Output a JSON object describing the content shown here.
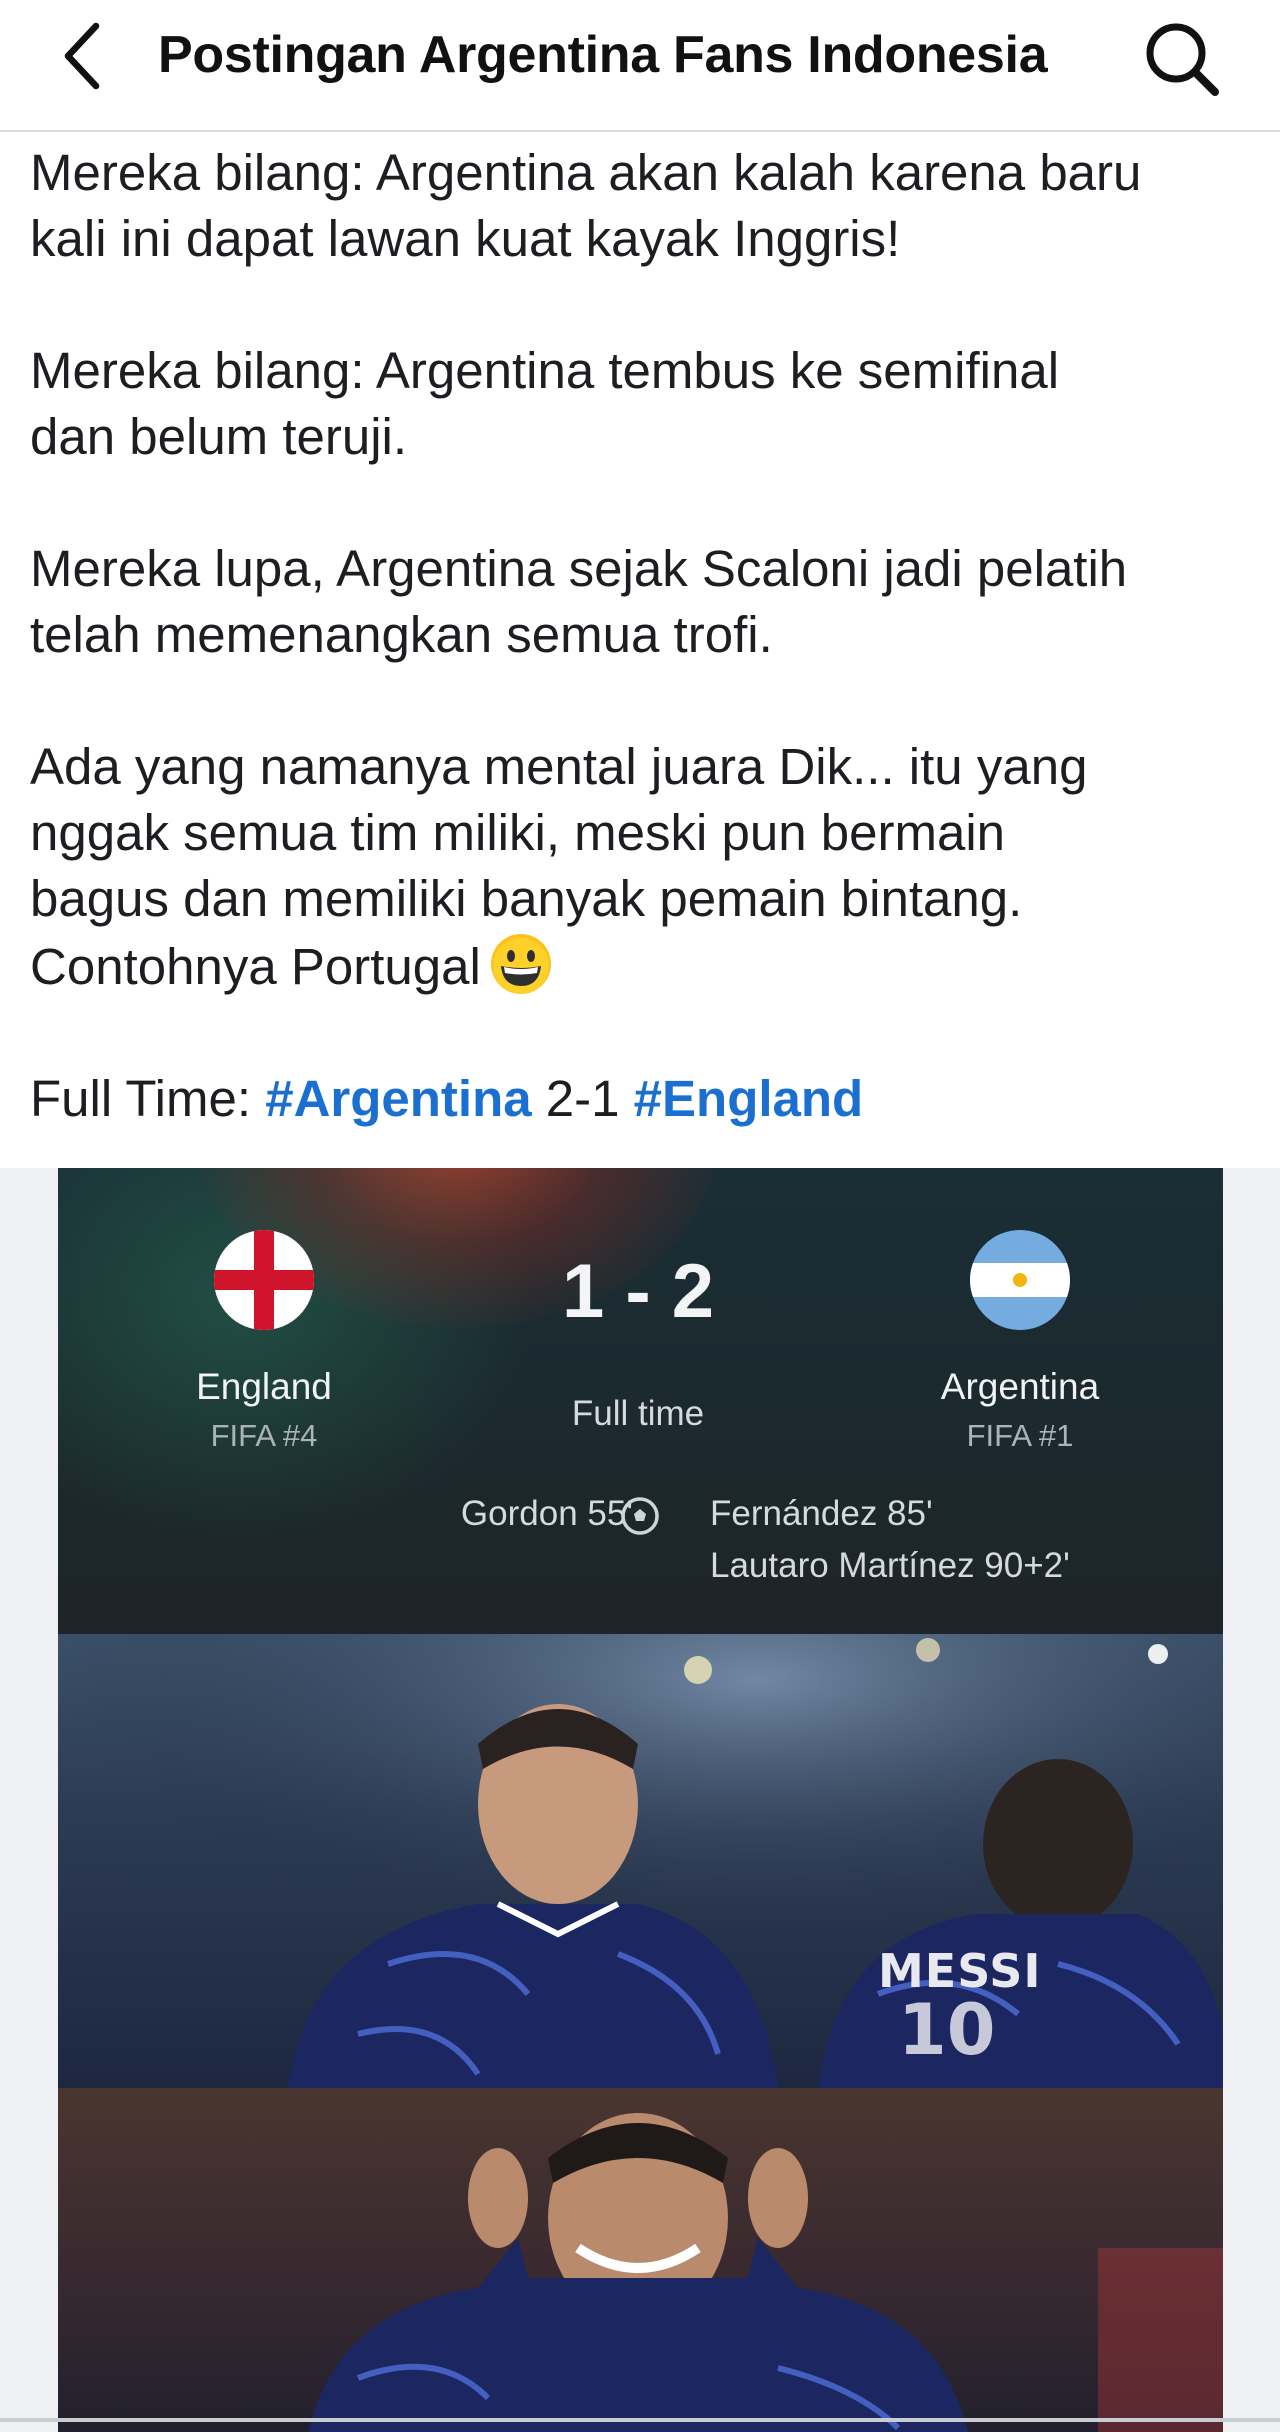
{
  "header": {
    "title": "Postingan Argentina Fans Indonesia",
    "back_icon": "chevron-left-icon",
    "search_icon": "search-icon"
  },
  "post": {
    "paragraphs": [
      [
        "Mereka bilang: Argentina akan kalah karena baru",
        "kali ini dapat lawan kuat kayak Inggris!"
      ],
      [
        "Mereka bilang: Argentina tembus ke semifinal",
        "dan belum teruji."
      ],
      [
        "Mereka lupa, Argentina sejak Scaloni jadi pelatih",
        "telah memenangkan semua trofi."
      ],
      [
        "Ada yang namanya mental juara Dik... itu yang",
        "nggak semua tim miliki, meski pun bermain",
        "bagus dan memiliki banyak pemain bintang.",
        "Contohnya Portugal"
      ]
    ],
    "final_prefix": "Full Time: ",
    "hashtag1": "#Argentina",
    "score_text": " 2-1 ",
    "hashtag2": "#England",
    "emoji": "grinning-face-emoji",
    "hashtag_color": "#1b6fd1"
  },
  "scorecard": {
    "score": "1 - 2",
    "status": "Full time",
    "home_team": "England",
    "home_rank": "FIFA #4",
    "away_team": "Argentina",
    "away_rank": "FIFA #1",
    "home_scorers": "Gordon 55'",
    "away_scorers": [
      "Fernández 85'",
      "Lautaro Martínez 90+2'"
    ],
    "ball_icon": "soccer-ball-icon"
  },
  "photos": {
    "jersey_name": "MESSI"
  }
}
